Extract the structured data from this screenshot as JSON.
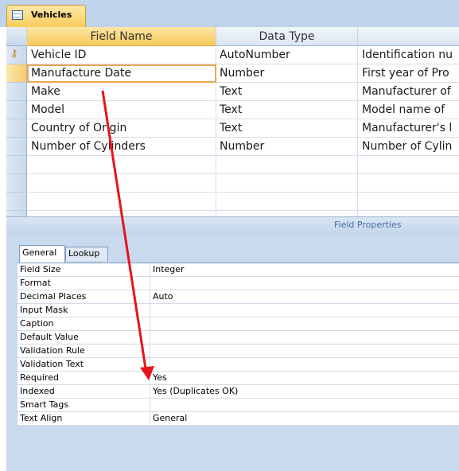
{
  "document_tab": {
    "label": "Vehicles",
    "icon": "table-icon"
  },
  "grid": {
    "headers": {
      "field_name": "Field Name",
      "data_type": "Data Type",
      "description": ""
    },
    "rows": [
      {
        "field_name": "Vehicle ID",
        "data_type": "AutoNumber",
        "description": "Identification nu",
        "primary_key": true
      },
      {
        "field_name": "Manufacture Date",
        "data_type": "Number",
        "description": "First year of Pro"
      },
      {
        "field_name": "Make",
        "data_type": "Text",
        "description": "Manufacturer of"
      },
      {
        "field_name": "Model",
        "data_type": "Text",
        "description": "Model name of"
      },
      {
        "field_name": "Country of Origin",
        "data_type": "Text",
        "description": "Manufacturer's l"
      },
      {
        "field_name": "Number of Cylinders",
        "data_type": "Number",
        "description": "Number of Cylin"
      },
      {
        "field_name": "",
        "data_type": "",
        "description": ""
      },
      {
        "field_name": "",
        "data_type": "",
        "description": ""
      },
      {
        "field_name": "",
        "data_type": "",
        "description": ""
      },
      {
        "field_name": "",
        "data_type": "",
        "description": ""
      }
    ]
  },
  "field_properties": {
    "title": "Field Properties",
    "tabs": {
      "general": "General",
      "lookup": "Lookup"
    },
    "properties": [
      {
        "label": "Field Size",
        "value": "Integer"
      },
      {
        "label": "Format",
        "value": ""
      },
      {
        "label": "Decimal Places",
        "value": "Auto"
      },
      {
        "label": "Input Mask",
        "value": ""
      },
      {
        "label": "Caption",
        "value": ""
      },
      {
        "label": "Default Value",
        "value": ""
      },
      {
        "label": "Validation Rule",
        "value": ""
      },
      {
        "label": "Validation Text",
        "value": ""
      },
      {
        "label": "Required",
        "value": "Yes"
      },
      {
        "label": "Indexed",
        "value": "Yes (Duplicates OK)"
      },
      {
        "label": "Smart Tags",
        "value": ""
      },
      {
        "label": "Text Align",
        "value": "General"
      }
    ]
  },
  "colors": {
    "arrow": "#e8141b",
    "active_header": "#f8c95a"
  }
}
